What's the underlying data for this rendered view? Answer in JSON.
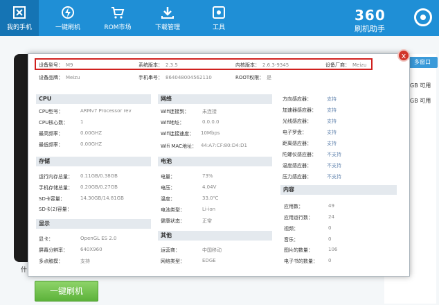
{
  "nav": [
    {
      "label": "我的手机",
      "icon": "phone-icon"
    },
    {
      "label": "一键刷机",
      "icon": "flash-icon"
    },
    {
      "label": "ROM市场",
      "icon": "cart-icon"
    },
    {
      "label": "下载管理",
      "icon": "download-icon"
    },
    {
      "label": "工具",
      "icon": "tools-icon"
    }
  ],
  "brand": {
    "number": "360",
    "sub": "刷机助手"
  },
  "background": {
    "multi_window": "多窗口",
    "available1": "GB 可用",
    "available2": "GB 可用",
    "flash_button": "一键刷机",
    "left_stub": "什"
  },
  "dialog": {
    "close": "x",
    "top_row1": {
      "model_label": "设备型号：",
      "model_value": "M9",
      "os_label": "系统版本：",
      "os_value": "2.3.5",
      "kernel_label": "内核版本：",
      "kernel_value": "2.6.3-9345",
      "vendor_label": "设备厂商：",
      "vendor_value": "Meizu"
    },
    "top_row2": {
      "brand_label": "设备品牌：",
      "brand_value": "Meizu",
      "serial_label": "手机串号：",
      "serial_value": "864048004562110",
      "root_label": "ROOT权限：",
      "root_value": "是"
    },
    "cpu": {
      "title": "CPU",
      "rows": [
        {
          "label": "CPU型号：",
          "value": "ARMv7 Processor rev"
        },
        {
          "label": "CPU核心数：",
          "value": "1"
        },
        {
          "label": "最高频率：",
          "value": "0.00GHZ"
        },
        {
          "label": "最低频率：",
          "value": "0.00GHZ"
        }
      ]
    },
    "storage": {
      "title": "存储",
      "rows": [
        {
          "label": "运行内存总量：",
          "value": "0.11GB/0.38GB"
        },
        {
          "label": "手机存储总量：",
          "value": "0.20GB/0.27GB"
        },
        {
          "label": "SD卡容量：",
          "value": "14.30GB/14.81GB"
        },
        {
          "label": "SD卡(2)容量：",
          "value": ""
        }
      ]
    },
    "display": {
      "title": "显示",
      "rows": [
        {
          "label": "显卡：",
          "value": "OpenGL ES 2.0"
        },
        {
          "label": "屏幕分辨率：",
          "value": "640X960"
        },
        {
          "label": "多点触摸：",
          "value": "支持"
        }
      ]
    },
    "network": {
      "title": "网络",
      "rows": [
        {
          "label": "Wifi连接到：",
          "value": "未连接"
        },
        {
          "label": "Wifi地址：",
          "value": "0.0.0.0"
        },
        {
          "label": "Wifi连接速度：",
          "value": "10Mbps"
        },
        {
          "label": "Wifi MAC地址：",
          "value": "44:A7:CF:80:D4:D1"
        }
      ]
    },
    "battery": {
      "title": "电池",
      "rows": [
        {
          "label": "电量：",
          "value": "73%"
        },
        {
          "label": "电压：",
          "value": "4.04V"
        },
        {
          "label": "温度：",
          "value": "33.0℃"
        },
        {
          "label": "电池类型：",
          "value": "Li-ion"
        },
        {
          "label": "健康状态：",
          "value": "正常"
        }
      ]
    },
    "other": {
      "title": "其他",
      "rows": [
        {
          "label": "运营商：",
          "value": "中国移动"
        },
        {
          "label": "网络类型：",
          "value": "EDGE"
        }
      ]
    },
    "sensors": {
      "rows": [
        {
          "label": "方向感应器：",
          "value": "支持"
        },
        {
          "label": "加速器感应器：",
          "value": "支持"
        },
        {
          "label": "光线感应器：",
          "value": "支持"
        },
        {
          "label": "电子罗盘：",
          "value": "支持"
        },
        {
          "label": "距离感应器：",
          "value": "支持"
        },
        {
          "label": "陀螺仪感应器：",
          "value": "不支持"
        },
        {
          "label": "温度感应器：",
          "value": "不支持"
        },
        {
          "label": "压力感应器：",
          "value": "不支持"
        }
      ]
    },
    "content": {
      "title": "内容",
      "rows": [
        {
          "label": "应用数：",
          "value": "49"
        },
        {
          "label": "应用运行数：",
          "value": "24"
        },
        {
          "label": "视频：",
          "value": "0"
        },
        {
          "label": "音乐：",
          "value": "0"
        },
        {
          "label": "图片的数量：",
          "value": "106"
        },
        {
          "label": "电子书的数量：",
          "value": "0"
        }
      ]
    }
  }
}
